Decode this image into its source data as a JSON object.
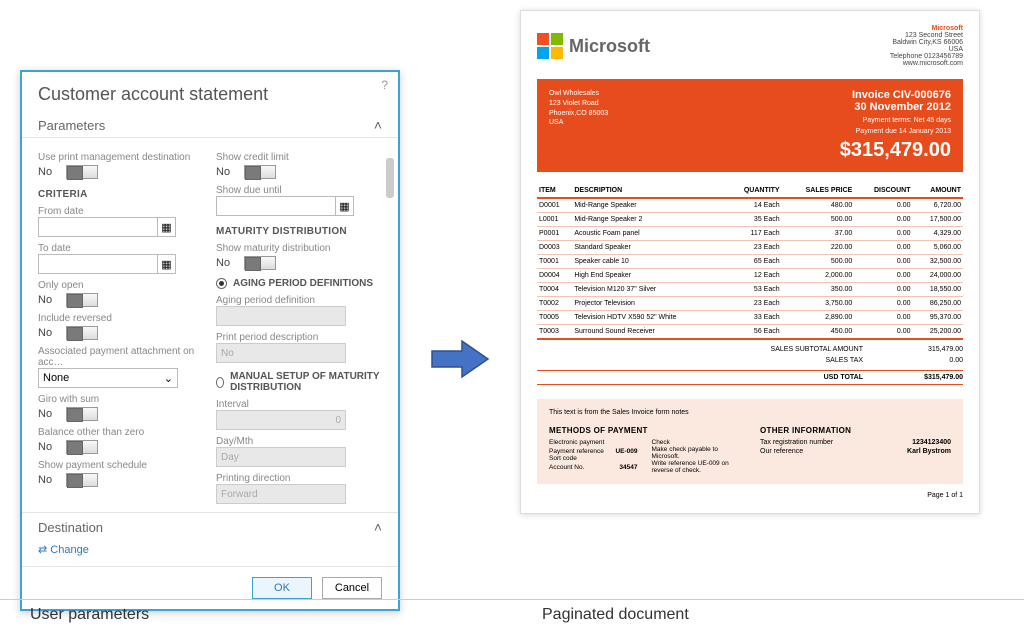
{
  "dialog": {
    "title": "Customer account statement",
    "sections": {
      "parameters": "Parameters",
      "destination": "Destination",
      "change": "⇄ Change"
    },
    "left": {
      "usePrintMgmt": {
        "label": "Use print management destination",
        "value": "No"
      },
      "criteria": "CRITERIA",
      "fromDate": "From date",
      "toDate": "To date",
      "onlyOpen": {
        "label": "Only open",
        "value": "No"
      },
      "includeReversed": {
        "label": "Include reversed",
        "value": "No"
      },
      "assocPayment": {
        "label": "Associated payment attachment on acc…",
        "value": "None"
      },
      "giroWithSum": {
        "label": "Giro with sum",
        "value": "No"
      },
      "balanceOther": {
        "label": "Balance other than zero",
        "value": "No"
      },
      "showPaySched": {
        "label": "Show payment schedule",
        "value": "No"
      }
    },
    "right": {
      "showCredit": {
        "label": "Show credit limit",
        "value": "No"
      },
      "showDueUntil": "Show due until",
      "maturityDist": "MATURITY DISTRIBUTION",
      "showMaturity": {
        "label": "Show maturity distribution",
        "value": "No"
      },
      "agingDefs": "AGING PERIOD DEFINITIONS",
      "agingPeriod": "Aging period definition",
      "printPeriod": {
        "label": "Print period description",
        "value": "No"
      },
      "manualSetup": "MANUAL SETUP OF MATURITY DISTRIBUTION",
      "interval": {
        "label": "Interval",
        "value": "0"
      },
      "dayMth": {
        "label": "Day/Mth",
        "value": "Day"
      },
      "printDir": {
        "label": "Printing direction",
        "value": "Forward"
      }
    },
    "buttons": {
      "ok": "OK",
      "cancel": "Cancel"
    }
  },
  "doc": {
    "brand": "Microsoft",
    "company": {
      "name": "Microsoft",
      "addr1": "123 Second Street",
      "addr2": "Baldwin City,KS 66006",
      "country": "USA",
      "phone": "Telephone 0123456789",
      "web": "www.microsoft.com"
    },
    "customer": {
      "name": "Owl Wholesales",
      "addr": "123 Violet Road",
      "city": "Phoenix,CO 85003",
      "country": "USA"
    },
    "invoice": {
      "number": "Invoice CIV-000676",
      "date": "30 November 2012",
      "terms": "Payment terms: Net 45 days",
      "due": "Payment due 14 January 2013",
      "total": "$315,479.00"
    },
    "columns": [
      "ITEM",
      "DESCRIPTION",
      "QUANTITY",
      "SALES PRICE",
      "DISCOUNT",
      "AMOUNT"
    ],
    "items": [
      {
        "id": "D0001",
        "desc": "Mid-Range Speaker",
        "qty": "14 Each",
        "price": "480.00",
        "disc": "0.00",
        "amt": "6,720.00"
      },
      {
        "id": "L0001",
        "desc": "Mid-Range Speaker 2",
        "qty": "35 Each",
        "price": "500.00",
        "disc": "0.00",
        "amt": "17,500.00"
      },
      {
        "id": "P0001",
        "desc": "Acoustic Foam panel",
        "qty": "117 Each",
        "price": "37.00",
        "disc": "0.00",
        "amt": "4,329.00"
      },
      {
        "id": "D0003",
        "desc": "Standard Speaker",
        "qty": "23 Each",
        "price": "220.00",
        "disc": "0.00",
        "amt": "5,060.00"
      },
      {
        "id": "T0001",
        "desc": "Speaker cable 10",
        "qty": "65 Each",
        "price": "500.00",
        "disc": "0.00",
        "amt": "32,500.00"
      },
      {
        "id": "D0004",
        "desc": "High End Speaker",
        "qty": "12 Each",
        "price": "2,000.00",
        "disc": "0.00",
        "amt": "24,000.00"
      },
      {
        "id": "T0004",
        "desc": "Television M120 37\" Silver",
        "qty": "53 Each",
        "price": "350.00",
        "disc": "0.00",
        "amt": "18,550.00"
      },
      {
        "id": "T0002",
        "desc": "Projector Television",
        "qty": "23 Each",
        "price": "3,750.00",
        "disc": "0.00",
        "amt": "86,250.00"
      },
      {
        "id": "T0005",
        "desc": "Television HDTV X590 52\" White",
        "qty": "33 Each",
        "price": "2,890.00",
        "disc": "0.00",
        "amt": "95,370.00"
      },
      {
        "id": "T0003",
        "desc": "Surround Sound Receiver",
        "qty": "56 Each",
        "price": "450.00",
        "disc": "0.00",
        "amt": "25,200.00"
      }
    ],
    "summary": {
      "subtotalLabel": "SALES SUBTOTAL AMOUNT",
      "subtotal": "315,479.00",
      "taxLabel": "SALES TAX",
      "tax": "0.00",
      "totalLabel": "USD TOTAL",
      "total": "$315,479.00"
    },
    "footer": {
      "note": "This text is from the Sales Invoice form notes",
      "methods": "METHODS OF PAYMENT",
      "electronic": "Electronic payment",
      "payref": {
        "label": "Payment reference",
        "value": "UE-009"
      },
      "sortcode": "Sort code",
      "acct": {
        "label": "Account No.",
        "value": "34547"
      },
      "check": "Check",
      "check1": "Make check payable to Microsoft.",
      "check2": "Write reference UE-009 on reverse of check.",
      "other": "OTHER INFORMATION",
      "taxreg": {
        "label": "Tax registration number",
        "value": "1234123400"
      },
      "ourref": {
        "label": "Our reference",
        "value": "Karl Bystrom"
      }
    },
    "page": "Page 1 of 1"
  },
  "captions": {
    "left": "User parameters",
    "right": "Paginated document"
  }
}
